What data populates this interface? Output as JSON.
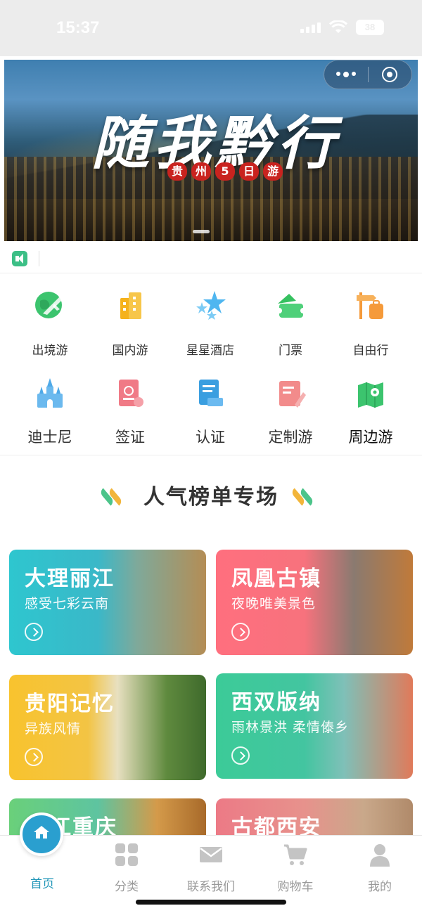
{
  "status_bar": {
    "time": "15:37",
    "battery": "38"
  },
  "banner": {
    "title": "随我黔行",
    "subtitle_chars": [
      "贵",
      "州",
      "5",
      "日",
      "游"
    ]
  },
  "categories_row1": [
    {
      "label": "出境游",
      "icon": "globe-plane-icon",
      "color": "#3cc46e"
    },
    {
      "label": "国内游",
      "icon": "city-building-icon",
      "color": "#f5b21c"
    },
    {
      "label": "星星酒店",
      "icon": "stars-icon",
      "color": "#4fb6f0"
    },
    {
      "label": "门票",
      "icon": "ticket-icon",
      "color": "#36c160"
    },
    {
      "label": "自由行",
      "icon": "luggage-signpost-icon",
      "color": "#f59a3a"
    }
  ],
  "categories_row2": [
    {
      "label": "迪士尼",
      "icon": "castle-icon",
      "color": "#4ea9e8"
    },
    {
      "label": "签证",
      "icon": "passport-icon",
      "color": "#f07a86"
    },
    {
      "label": "认证",
      "icon": "certificate-icon",
      "color": "#3a9ee0"
    },
    {
      "label": "定制游",
      "icon": "custom-plan-icon",
      "color": "#f28b8b"
    },
    {
      "label": "周边游",
      "icon": "map-pin-icon",
      "color": "#3cc46e"
    }
  ],
  "section": {
    "title": "人气榜单专场"
  },
  "destinations": [
    {
      "name": "大理丽江",
      "desc": "感受七彩云南"
    },
    {
      "name": "凤凰古镇",
      "desc": "夜晚唯美景色"
    },
    {
      "name": "贵阳记忆",
      "desc": "异族风情"
    },
    {
      "name": "西双版纳",
      "desc": "雨林景洪 柔情傣乡"
    },
    {
      "name": "江重庆",
      "desc": ""
    },
    {
      "name": "古都西安",
      "desc": ""
    }
  ],
  "tabbar": {
    "items": [
      {
        "label": "首页",
        "icon": "home-icon",
        "active": true
      },
      {
        "label": "分类",
        "icon": "grid-icon",
        "active": false
      },
      {
        "label": "联系我们",
        "icon": "mail-icon",
        "active": false
      },
      {
        "label": "购物车",
        "icon": "cart-icon",
        "active": false
      },
      {
        "label": "我的",
        "icon": "user-icon",
        "active": false
      }
    ]
  }
}
